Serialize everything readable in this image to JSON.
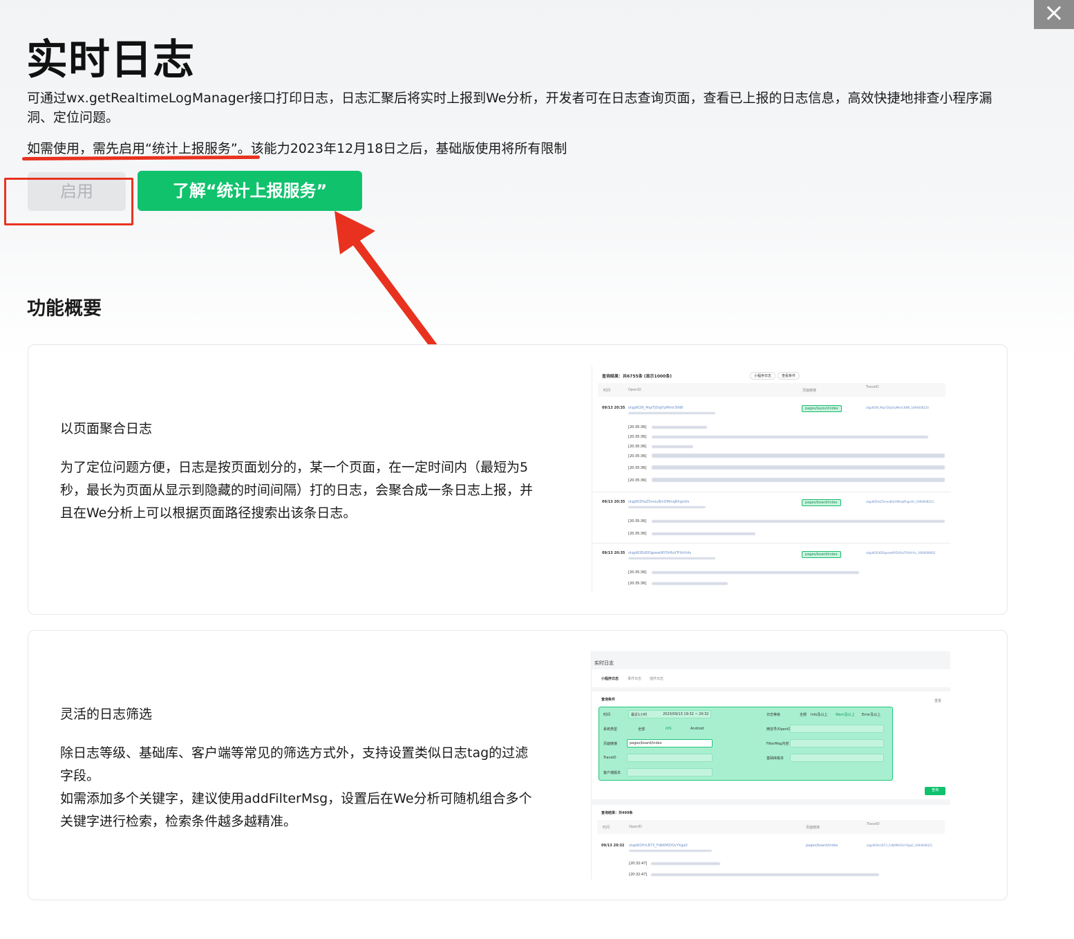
{
  "window": {
    "close_glyph": "×"
  },
  "page": {
    "title": "实时日志",
    "description": "可通过wx.getRealtimeLogManager接口打印日志，日志汇聚后将实时上报到We分析，开发者可在日志查询页面，查看已上报的日志信息，高效快捷地排查小程序漏洞、定位问题。",
    "notice_prefix": "如需使用，需先启用“统计上报服务”",
    "notice_suffix": "。该能力2023年12月18日之后，基础版使用将所有限制"
  },
  "actions": {
    "enable_label": "启用",
    "learn_label": "了解“统计上报服务”"
  },
  "overview": {
    "title": "功能概要",
    "cards": [
      {
        "heading": "以页面聚合日志",
        "text": "为了定位问题方便，日志是按页面划分的，某一个页面，在一定时间内（最短为5秒，最长为页面从显示到隐藏的时间间隔）打的日志，会聚合成一条日志上报，并且在We分析上可以根据页面路径搜索出该条日志。"
      },
      {
        "heading": "灵活的日志筛选",
        "text_line1": "除日志等级、基础库、客户端等常见的筛选方式外，支持设置类似日志tag的过滤字段。",
        "text_line2": "如需添加多个关键字，建议使用addFilterMsg，设置后在We分析可随机组合多个关键字进行检索，检索条件越多越精准。"
      }
    ]
  },
  "screenshot1": {
    "result_title": "查询结果：共6755条 (显示1000条)",
    "tab1": "小程序日志",
    "tab2": "查看条件",
    "col_time": "时间",
    "col_openid": "OpenID",
    "col_page": "页面链接",
    "col_trace": "TraceID",
    "rows": [
      {
        "time": "09/13 20:35",
        "openid": "olqpW2N_MqsTJOaJYpMmlr3tN8",
        "page": "pages/layout/index",
        "trace": "olqpW2N_MqsTJOaJYpMmlr3tN8_1694608220"
      },
      {
        "time": "09/13 20:35",
        "openid": "olqpW2HaZ5mouBmOMmqRhgsUIs",
        "page": "pages/board/index",
        "trace": "olqpW2HaZ5mouBmOMmqRhgsUIs_1694608223"
      },
      {
        "time": "09/13 20:35",
        "openid": "olqpW2EdDDgoewWYDrRsVTrYoVrAs",
        "page": "pages/board/index",
        "trace": "olqpW2EdDDgoewWYDrRsVTrYoVrAs_1694608062"
      }
    ],
    "sub_time": "[20:35:36]"
  },
  "screenshot2": {
    "title": "实时日志",
    "tab1": "小程序日志",
    "tab2": "事件日志",
    "tab3": "插件日志",
    "query_title": "查询条件",
    "reset": "重置",
    "f_time": "时间",
    "f_time_val": "最近1小时",
    "f_range": "2023/09/13 19:32 ~ 20:32",
    "f_level": "日志等级",
    "f_level_all": "全部",
    "f_info": "Info及以上",
    "f_warn": "Warn及以上",
    "f_error": "Error及以上",
    "f_sys": "系统类型",
    "f_sys_all": "全部",
    "f_ios": "iOS",
    "f_android": "Android",
    "f_openid": "微信号/OpenID",
    "f_page": "页面链接",
    "f_page_val": "pages/board/index",
    "f_filter": "FilterMsg内容",
    "f_trace": "TraceID",
    "f_keyword": "基础库版本",
    "f_client": "客户端版本",
    "search_btn": "查询",
    "result_title": "查询结果：共499条",
    "col_time": "时间",
    "col_openid": "OpenID",
    "col_page": "页面链接",
    "col_trace": "TraceID",
    "row_time": "09/13 20:32",
    "row_openid": "olqpW2HrLB73_Fdb6MiOOvYXga0",
    "row_page": "pages/board/index",
    "row_trace": "olqpW2HrLB73_Fdb6MiOOvYXga0_1694608321",
    "sub_time": "[20:32:47]"
  }
}
